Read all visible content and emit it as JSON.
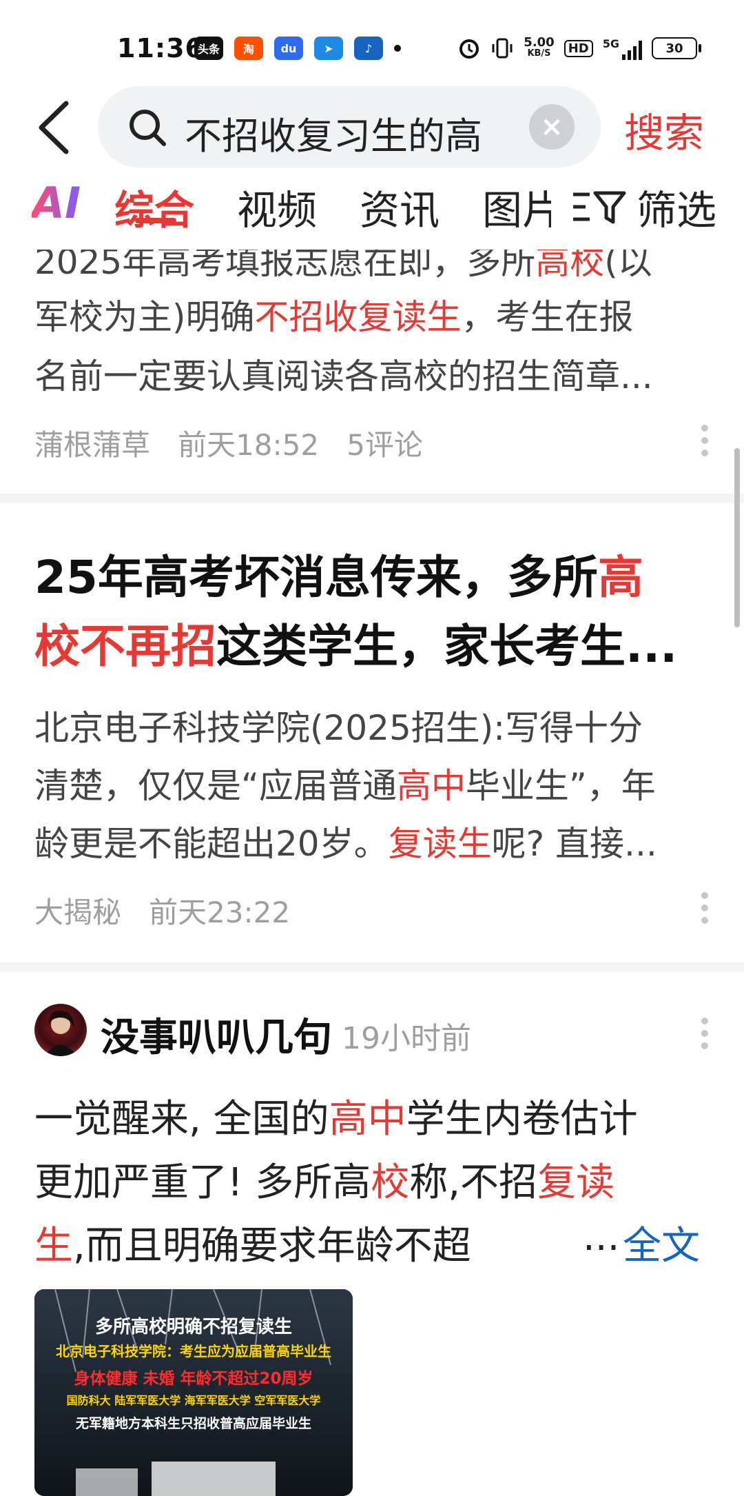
{
  "status_bar": {
    "time": "11:36",
    "apps": [
      {
        "label": "头条",
        "color": "#111111"
      },
      {
        "label": "淘",
        "color": "#ff5000"
      },
      {
        "label": "du",
        "color": "#2d6cf0"
      },
      {
        "label": "➤",
        "color": "#1e88e5"
      },
      {
        "label": "♪",
        "color": "#1565c0"
      }
    ],
    "net_speed_value": "5.00",
    "net_speed_unit": "KB/S",
    "hd_label": "HD",
    "network": "5G",
    "battery": "30"
  },
  "search": {
    "query": "不招收复习生的高",
    "clear_icon": "×",
    "button_label": "搜索"
  },
  "tabs": {
    "ai_label": "AI",
    "items": [
      "综合",
      "视频",
      "资讯",
      "图片"
    ],
    "active": "综合",
    "filter_label": "筛选"
  },
  "card1": {
    "line1_a": "2025年高考填报志愿在即，多所",
    "line1_hl": "高校",
    "line1_b": "(以",
    "line2_a": "军校为主)明确",
    "line2_hl": "不招收复读生",
    "line2_b": "，考生在报",
    "line3": "名前一定要认真阅读各高校的招生简章...",
    "source": "蒲根蒲草",
    "time": "前天18:52",
    "comments": "5评论"
  },
  "card2": {
    "title1_a": "25年高考坏消息传来，多所",
    "title1_hl": "高",
    "title2_hl": "校不再招",
    "title2_b": "这类学生，家长考生...",
    "line1": "北京电子科技学院(2025招生):写得十分",
    "line2_a": "清楚，仅仅是“应届普通",
    "line2_hl": "高中",
    "line2_b": "毕业生”，年",
    "line3_a": "龄更是不能超出20岁。",
    "line3_hl": "复读生",
    "line3_b": "呢? 直接...",
    "source": "大揭秘",
    "time": "前天23:22"
  },
  "post": {
    "author": "没事叭叭几句",
    "time": "19小时前",
    "line1_a": "一觉醒来, 全国的",
    "line1_hl": "高中",
    "line1_b": "学生内卷估计",
    "line2_a": "更加严重了! 多所高",
    "line2_hl1": "校",
    "line2_b": "称,不招",
    "line2_hl2": "复读",
    "line3_hl": "生",
    "line3_b": ",而且明确要求年龄不超",
    "ellipsis": "...",
    "fulltext": "全文",
    "thumb_lines": [
      {
        "text": "多所高校明确不招复读生",
        "color": "#ffffff"
      },
      {
        "text": "北京电子科技学院：考生应为应届普高毕业生",
        "color": "#ffd400"
      },
      {
        "text": "身体健康 未婚 年龄不超过20周岁",
        "color": "#ff2d2d"
      },
      {
        "text": "国防科大  陆军军医大学  海军军医大学  空军军医大学",
        "color": "#ffd400"
      },
      {
        "text": "无军籍地方本科生只招收普高应届毕业生",
        "color": "#ffffff"
      }
    ]
  }
}
